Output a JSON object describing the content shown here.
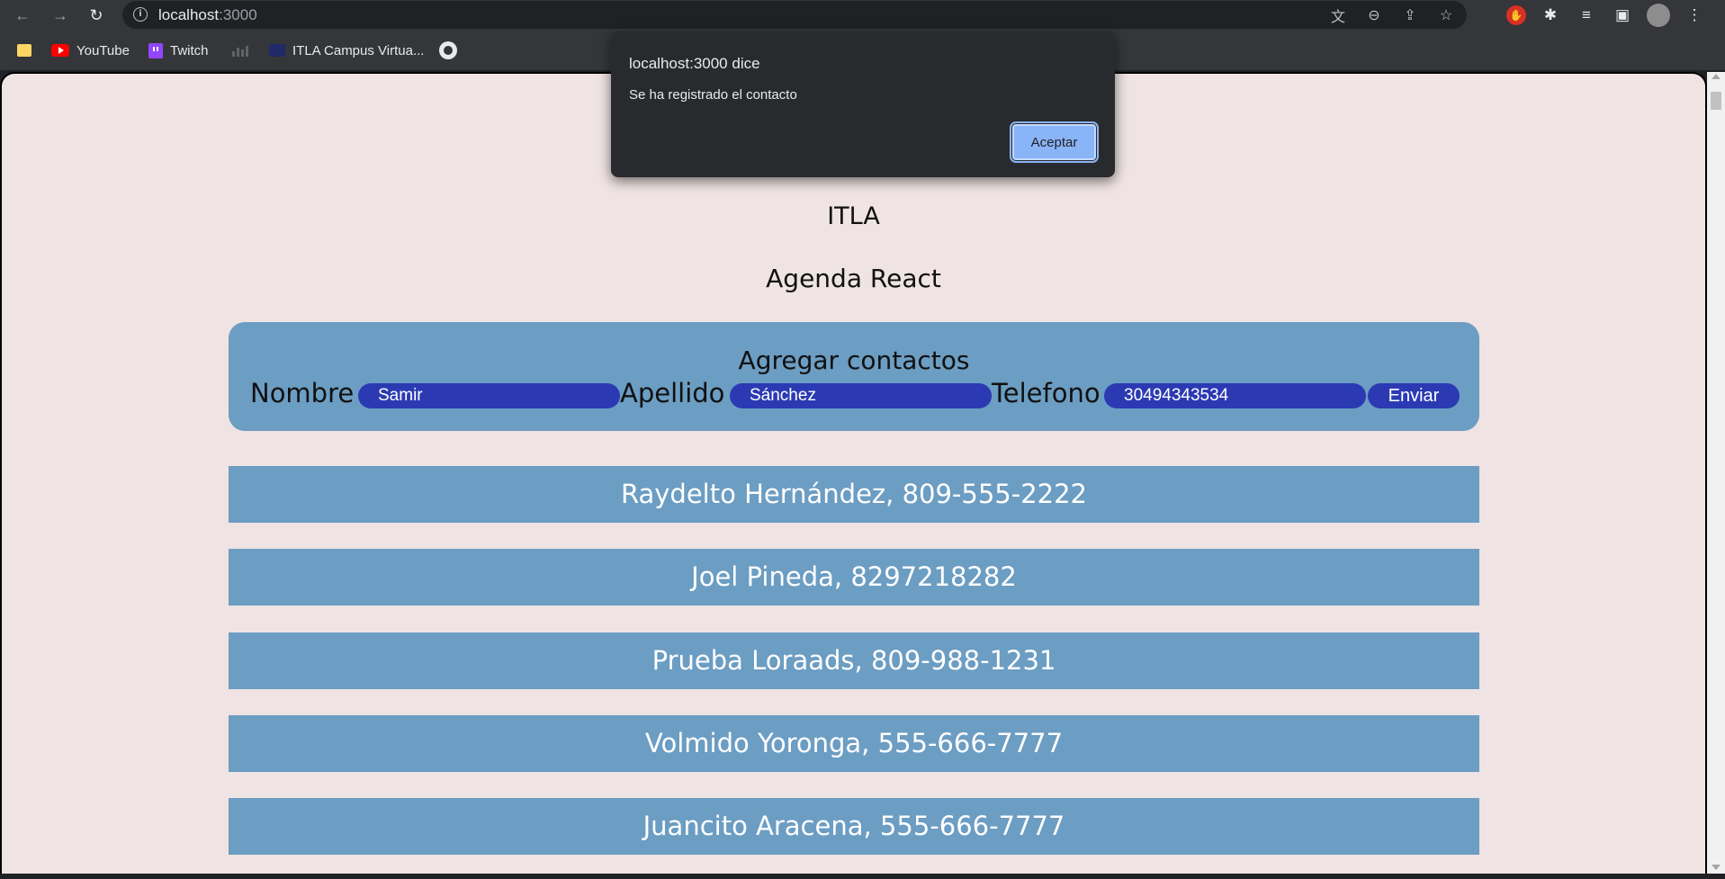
{
  "browser": {
    "url_host": "localhost",
    "url_port": ":3000",
    "bookmarks": [
      {
        "label": ""
      },
      {
        "label": "YouTube"
      },
      {
        "label": "Twitch"
      },
      {
        "label": ""
      },
      {
        "label": "ITLA Campus Virtua..."
      },
      {
        "label": ""
      }
    ]
  },
  "page": {
    "title": "ITLA",
    "subtitle": "Agenda React"
  },
  "form": {
    "heading": "Agregar contactos",
    "nombre_label": "Nombre :",
    "nombre_value": "Samir",
    "apellido_label": "Apellido :",
    "apellido_value": "Sánchez",
    "telefono_label": "Telefono :",
    "telefono_value": "30494343534",
    "submit_label": "Enviar"
  },
  "contacts": [
    {
      "text": "Raydelto Hernández, 809-555-2222"
    },
    {
      "text": "Joel Pineda, 8297218282"
    },
    {
      "text": "Prueba Loraads, 809-988-1231"
    },
    {
      "text": "Volmido Yoronga, 555-666-7777"
    },
    {
      "text": "Juancito Aracena, 555-666-7777"
    }
  ],
  "dialog": {
    "title": "localhost:3000 dice",
    "message": "Se ha registrado el contacto",
    "ok_label": "Aceptar"
  },
  "colors": {
    "page_bg": "#efe3e3",
    "card_bg": "#6c9dc3",
    "input_bg": "#2b3ab3",
    "dialog_bg": "#292a2d",
    "dialog_button": "#8ab4f8"
  }
}
